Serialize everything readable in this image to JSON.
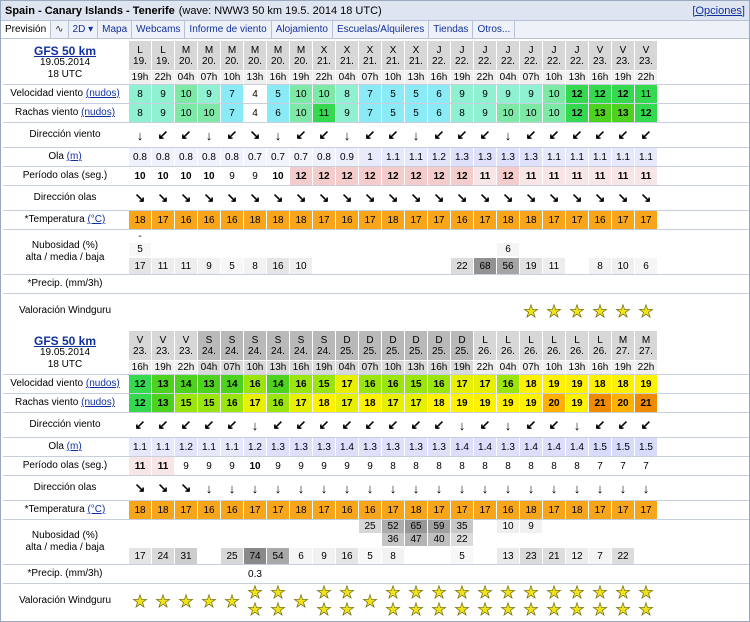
{
  "header": {
    "location": "Spain - Canary Islands - Tenerife",
    "subtitle": "(wave: NWW3 50 km 19.5. 2014 18 UTC)",
    "options_link": "[Opciones]"
  },
  "tabs": [
    "Previsión",
    "∿",
    "2D ▾",
    "Mapa",
    "Webcams",
    "Informe de viento",
    "Alojamiento",
    "Escuelas/Alquileres",
    "Tiendas",
    "Otros..."
  ],
  "colors": {
    "header_bg": "#dfe5f0",
    "wind_scale": [
      "#8aeaf5",
      "#8ff0d2",
      "#7ee8a6",
      "#34d94f",
      "#4dd21f",
      "#9be50f",
      "#e6f000",
      "#fff200",
      "#ffb000",
      "#f08a00"
    ],
    "wave_cell": "#e6e9f7",
    "period_strong": "#f5cccc",
    "temperature": "#f7a61c"
  },
  "labels": {
    "velocidad": "Velocidad viento",
    "rachas": "Rachas viento",
    "units_wind": "(nudos)",
    "direccion_viento": "Dirección viento",
    "ola": "Ola",
    "units_wave": "(m)",
    "periodo": "Período olas (seg.)",
    "direccion_olas": "Dirección olas",
    "temperatura": "*Temperatura",
    "units_temp": "(°C)",
    "nubosidad_1": "Nubosidad (%)",
    "nubosidad_2": "alta / media / baja",
    "precip": "*Precip. (mm/3h)",
    "valoracion": "Valoración Windguru"
  },
  "blocks": [
    {
      "model": "GFS 50 km",
      "date": "19.05.2014",
      "time": "18 UTC",
      "days": [
        "L",
        "L",
        "M",
        "M",
        "M",
        "M",
        "M",
        "M",
        "X",
        "X",
        "X",
        "X",
        "X",
        "J",
        "J",
        "J",
        "J",
        "J",
        "J",
        "J",
        "V",
        "V",
        "V"
      ],
      "dates": [
        "19.",
        "19.",
        "20.",
        "20.",
        "20.",
        "20.",
        "20.",
        "20.",
        "21.",
        "21.",
        "21.",
        "21.",
        "21.",
        "22.",
        "22.",
        "22.",
        "22.",
        "22.",
        "22.",
        "22.",
        "23.",
        "23.",
        "23."
      ],
      "hours": [
        "19h",
        "22h",
        "04h",
        "07h",
        "10h",
        "13h",
        "16h",
        "19h",
        "22h",
        "04h",
        "07h",
        "10h",
        "13h",
        "16h",
        "19h",
        "22h",
        "04h",
        "07h",
        "10h",
        "13h",
        "16h",
        "19h",
        "22h"
      ],
      "wind": [
        "8",
        "9",
        "10",
        "9",
        "7",
        "4",
        "5",
        "10",
        "10",
        "8",
        "7",
        "5",
        "5",
        "6",
        "9",
        "9",
        "9",
        "9",
        "10",
        "12",
        "12",
        "12",
        "11"
      ],
      "gusts": [
        "8",
        "9",
        "10",
        "10",
        "7",
        "4",
        "6",
        "10",
        "11",
        "9",
        "7",
        "5",
        "5",
        "6",
        "8",
        "9",
        "10",
        "10",
        "10",
        "12",
        "13",
        "13",
        "12"
      ],
      "wind_dir": [
        "↓",
        "↙",
        "↙",
        "↓",
        "↙",
        "↘",
        "↓",
        "↙",
        "↙",
        "↓",
        "↙",
        "↙",
        "↓",
        "↙",
        "↙",
        "↙",
        "↓",
        "↙",
        "↙",
        "↙",
        "↙",
        "↙",
        "↙"
      ],
      "wave": [
        "0.8",
        "0.8",
        "0.8",
        "0.8",
        "0.8",
        "0.7",
        "0.7",
        "0.7",
        "0.8",
        "0.9",
        "1",
        "1.1",
        "1.1",
        "1.2",
        "1.3",
        "1.3",
        "1.3",
        "1.3",
        "1.1",
        "1.1",
        "1.1",
        "1.1",
        "1.1"
      ],
      "period": [
        "10",
        "10",
        "10",
        "10",
        "9",
        "9",
        "10",
        "12",
        "12",
        "12",
        "12",
        "12",
        "12",
        "12",
        "12",
        "11",
        "12",
        "11",
        "11",
        "11",
        "11",
        "11",
        "11"
      ],
      "wave_dir": [
        "↘",
        "↘",
        "↘",
        "↘",
        "↘",
        "↘",
        "↘",
        "↘",
        "↘",
        "↘",
        "↘",
        "↘",
        "↘",
        "↘",
        "↘",
        "↘",
        "↘",
        "↘",
        "↘",
        "↘",
        "↘",
        "↘",
        "↘"
      ],
      "temp": [
        "18",
        "17",
        "16",
        "16",
        "16",
        "18",
        "18",
        "18",
        "17",
        "16",
        "17",
        "18",
        "17",
        "17",
        "16",
        "17",
        "18",
        "18",
        "17",
        "17",
        "16",
        "17",
        "17"
      ],
      "cloud_high": [
        "-",
        "",
        "",
        "",
        "",
        "",
        "",
        "",
        "",
        "",
        "",
        "",
        "",
        "",
        "",
        "",
        "",
        "",
        "",
        "",
        "",
        "",
        ""
      ],
      "cloud_mid": [
        "5",
        "",
        "",
        "",
        "",
        "",
        "",
        "",
        "",
        "",
        "",
        "",
        "",
        "",
        "",
        "",
        "6",
        "",
        "",
        "",
        "",
        "",
        ""
      ],
      "cloud_low": [
        "17",
        "11",
        "11",
        "9",
        "5",
        "8",
        "16",
        "10",
        "",
        "",
        "",
        "",
        "",
        "",
        "22",
        "68",
        "56",
        "19",
        "11",
        "",
        "8",
        "10",
        "6",
        "5"
      ],
      "precip": [
        "",
        "",
        "",
        "",
        "",
        "",
        "",
        "",
        "",
        "",
        "",
        "",
        "",
        "",
        "",
        "",
        "",
        "",
        "",
        "",
        "",
        "",
        ""
      ],
      "stars": [
        0,
        0,
        0,
        0,
        0,
        0,
        0,
        0,
        0,
        0,
        0,
        0,
        0,
        0,
        0,
        0,
        0,
        1,
        1,
        1,
        1,
        1,
        1
      ]
    },
    {
      "model": "GFS 50 km",
      "date": "19.05.2014",
      "time": "18 UTC",
      "days": [
        "V",
        "V",
        "V",
        "S",
        "S",
        "S",
        "S",
        "S",
        "S",
        "D",
        "D",
        "D",
        "D",
        "D",
        "D",
        "L",
        "L",
        "L",
        "L",
        "L",
        "L",
        "M",
        "M"
      ],
      "dates": [
        "23.",
        "23.",
        "23.",
        "24.",
        "24.",
        "24.",
        "24.",
        "24.",
        "24.",
        "25.",
        "25.",
        "25.",
        "25.",
        "25.",
        "25.",
        "26.",
        "26.",
        "26.",
        "26.",
        "26.",
        "26.",
        "27.",
        "27."
      ],
      "hours": [
        "16h",
        "19h",
        "22h",
        "04h",
        "07h",
        "10h",
        "13h",
        "16h",
        "19h",
        "04h",
        "07h",
        "10h",
        "13h",
        "16h",
        "19h",
        "22h",
        "04h",
        "07h",
        "10h",
        "13h",
        "16h",
        "19h",
        "22h"
      ],
      "wind": [
        "12",
        "13",
        "14",
        "13",
        "14",
        "16",
        "14",
        "16",
        "15",
        "17",
        "16",
        "16",
        "15",
        "16",
        "17",
        "17",
        "16",
        "18",
        "19",
        "19",
        "18",
        "18",
        "19"
      ],
      "gusts": [
        "12",
        "13",
        "15",
        "15",
        "16",
        "17",
        "16",
        "17",
        "18",
        "17",
        "18",
        "17",
        "17",
        "18",
        "19",
        "19",
        "19",
        "19",
        "20",
        "19",
        "21",
        "20",
        "21"
      ],
      "wind_dir": [
        "↙",
        "↙",
        "↙",
        "↙",
        "↙",
        "↓",
        "↙",
        "↙",
        "↙",
        "↙",
        "↙",
        "↙",
        "↙",
        "↙",
        "↓",
        "↙",
        "↓",
        "↙",
        "↙",
        "↓",
        "↙",
        "↙",
        "↙"
      ],
      "wave": [
        "1.1",
        "1.1",
        "1.2",
        "1.1",
        "1.1",
        "1.2",
        "1.3",
        "1.3",
        "1.3",
        "1.4",
        "1.3",
        "1.3",
        "1.3",
        "1.3",
        "1.4",
        "1.4",
        "1.3",
        "1.4",
        "1.4",
        "1.4",
        "1.5",
        "1.5",
        "1.5"
      ],
      "period": [
        "11",
        "11",
        "9",
        "9",
        "9",
        "10",
        "9",
        "9",
        "9",
        "9",
        "9",
        "8",
        "8",
        "8",
        "8",
        "8",
        "8",
        "8",
        "8",
        "8",
        "7",
        "7",
        "7"
      ],
      "wave_dir": [
        "↘",
        "↘",
        "↘",
        "↓",
        "↓",
        "↓",
        "↓",
        "↓",
        "↓",
        "↓",
        "↓",
        "↓",
        "↓",
        "↓",
        "↓",
        "↓",
        "↓",
        "↓",
        "↓",
        "↓",
        "↓",
        "↓",
        "↓"
      ],
      "temp": [
        "18",
        "18",
        "17",
        "16",
        "16",
        "17",
        "17",
        "18",
        "17",
        "16",
        "16",
        "17",
        "18",
        "17",
        "17",
        "17",
        "16",
        "18",
        "17",
        "18",
        "17",
        "17",
        "17"
      ],
      "cloud_high": [
        "",
        "",
        "",
        "",
        "",
        "",
        "",
        "",
        "",
        "",
        "25",
        "52",
        "65",
        "59",
        "35",
        "",
        "10",
        "9",
        "",
        "",
        "",
        "",
        ""
      ],
      "cloud_mid": [
        "",
        "",
        "",
        "",
        "",
        "",
        "",
        "",
        "",
        "",
        "",
        "36",
        "47",
        "40",
        "22",
        "",
        "",
        "",
        "",
        "",
        "",
        "",
        ""
      ],
      "cloud_low": [
        "17",
        "24",
        "31",
        "",
        "25",
        "74",
        "54",
        "6",
        "9",
        "16",
        "5",
        "8",
        "",
        "",
        "5",
        "",
        "13",
        "23",
        "21",
        "12",
        "7",
        "22",
        "",
        "5"
      ],
      "precip": [
        "",
        "",
        "",
        "",
        "",
        "0.3",
        "",
        "",
        "",
        "",
        "",
        "",
        "",
        "",
        "",
        "",
        "",
        "",
        "",
        "",
        "",
        "",
        ""
      ],
      "stars": [
        1,
        1,
        1,
        1,
        1,
        2,
        2,
        1,
        2,
        2,
        1,
        2,
        2,
        2,
        2,
        2,
        2,
        2,
        2,
        2,
        2,
        2,
        2
      ]
    }
  ]
}
